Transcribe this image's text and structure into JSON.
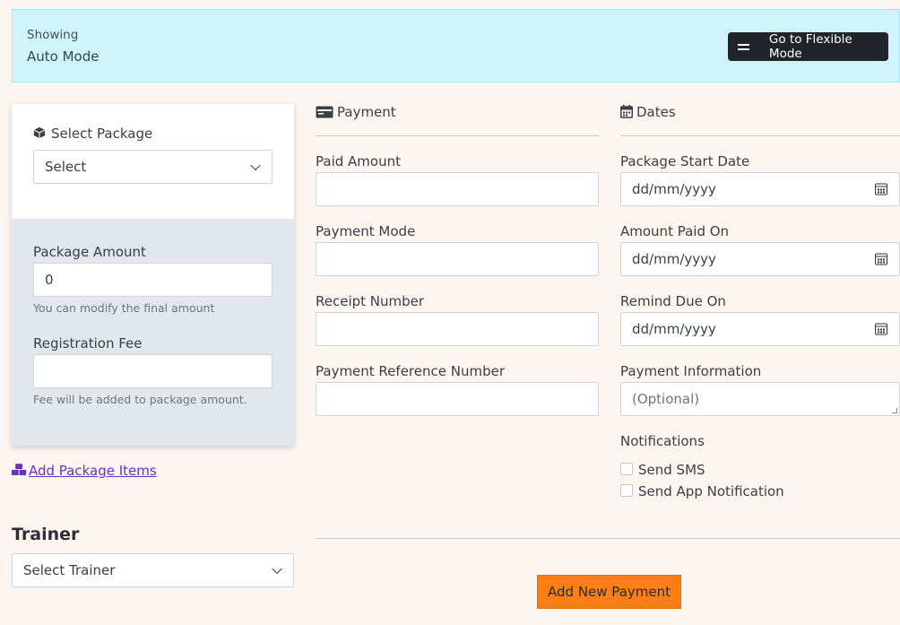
{
  "banner": {
    "showing_label": "Showing",
    "mode_name": "Auto Mode",
    "switch_button": "Go to Flexible Mode"
  },
  "package": {
    "label": "Select Package",
    "select_value": "Select",
    "amount_label": "Package Amount",
    "amount_value": "0",
    "amount_hint": "You can modify the final amount",
    "fee_label": "Registration Fee",
    "fee_value": "",
    "fee_hint": "Fee will be added to package amount.",
    "add_items_link": "Add Package Items"
  },
  "trainer": {
    "heading": "Trainer",
    "select_value": "Select Trainer"
  },
  "payment": {
    "heading": "Payment",
    "paid_amount_label": "Paid Amount",
    "paid_amount_value": "",
    "mode_label": "Payment Mode",
    "mode_value": "",
    "receipt_label": "Receipt Number",
    "receipt_value": "",
    "reference_label": "Payment Reference Number",
    "reference_value": ""
  },
  "dates": {
    "heading": "Dates",
    "start_label": "Package Start Date",
    "start_placeholder": "dd/mm/yyyy",
    "paid_on_label": "Amount Paid On",
    "paid_on_placeholder": "dd/mm/yyyy",
    "remind_label": "Remind Due On",
    "remind_placeholder": "dd/mm/yyyy",
    "info_label": "Payment Information",
    "info_placeholder": "(Optional)"
  },
  "notifications": {
    "heading": "Notifications",
    "sms_label": "Send SMS",
    "sms_checked": false,
    "app_label": "Send App Notification",
    "app_checked": false
  },
  "actions": {
    "submit": "Add New Payment"
  },
  "colors": {
    "banner_bg": "#cff4fc",
    "page_bg": "#fdf5ef",
    "submit_bg": "#fd7e14",
    "dark_button": "#212529",
    "link": "#6a2fc4"
  }
}
